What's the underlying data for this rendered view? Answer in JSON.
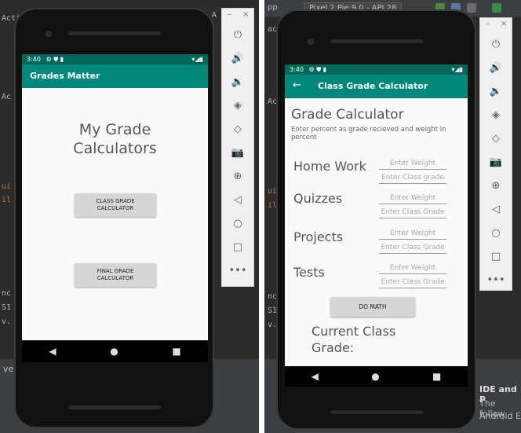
{
  "ide": {
    "left_snippets": [
      "Acti",
      "Ac",
      "ui",
      "il",
      "nc",
      "S1",
      "v."
    ],
    "right_snippets": [
      "acti",
      "Ac",
      "ui",
      "il",
      "nc",
      "S1",
      "v."
    ],
    "device_selector": "Pixel 2 Pie 9.0 - API 28",
    "app_label": "pp",
    "left_bottom_text": "ver",
    "right_bottom_title": "IDE and P",
    "right_bottom_line1": "The follow",
    "right_bottom_line2": "Android E",
    "left_far_right_text": "A"
  },
  "emulator_controls": {
    "minimize": "–",
    "close": "×",
    "buttons": [
      {
        "name": "power-icon",
        "glyph": "⏻"
      },
      {
        "name": "volume-up-icon",
        "glyph": "🔊"
      },
      {
        "name": "volume-down-icon",
        "glyph": "🔉"
      },
      {
        "name": "rotate-left-icon",
        "glyph": "◈"
      },
      {
        "name": "rotate-right-icon",
        "glyph": "◇"
      },
      {
        "name": "camera-icon",
        "glyph": "📷"
      },
      {
        "name": "zoom-icon",
        "glyph": "⊕"
      },
      {
        "name": "back-icon",
        "glyph": "◁"
      },
      {
        "name": "home-icon",
        "glyph": "○"
      },
      {
        "name": "overview-icon",
        "glyph": "□"
      },
      {
        "name": "more-icon",
        "glyph": "•••"
      }
    ]
  },
  "left_phone": {
    "status_time": "3:40",
    "status_icons": "⚙ ⛊ ▮",
    "status_right": "▾◢▮",
    "app_title": "Grades Matter",
    "heading_line1": "My Grade",
    "heading_line2": "Calculators",
    "class_button_line1": "CLASS GRADE",
    "class_button_line2": "CALCULATOR",
    "final_button_line1": "FINAL GRADE",
    "final_button_line2": "CALCULATOR",
    "nav_back": "◀",
    "nav_home": "●",
    "nav_recent": "■"
  },
  "right_phone": {
    "status_time": "3:40",
    "status_icons": "⚙ ⛊ ▮",
    "status_right": "▾◢▮",
    "back_arrow": "←",
    "app_title": "Class Grade Calculator",
    "heading": "Grade Calculator",
    "description": "Enter percent as grade recieved and weight in percent",
    "rows": [
      {
        "label": "Home Work",
        "weight_placeholder": "Enter Weight",
        "grade_placeholder": "Enter Class grade"
      },
      {
        "label": "Quizzes",
        "weight_placeholder": "Enter Weight",
        "grade_placeholder": "Enter Class Grade"
      },
      {
        "label": "Projects",
        "weight_placeholder": "Enter Weight",
        "grade_placeholder": "Enter Class Grade"
      },
      {
        "label": "Tests",
        "weight_placeholder": "Enter Weight",
        "grade_placeholder": "Enter Class Grade"
      }
    ],
    "do_math_button": "DO MATH",
    "result_line1": "Current Class",
    "result_line2": "Grade:",
    "nav_back": "◀",
    "nav_home": "●",
    "nav_recent": "■"
  },
  "colors": {
    "appbar": "#00897b",
    "statusbar": "#00685a",
    "button_grey": "#d6d6d6"
  }
}
